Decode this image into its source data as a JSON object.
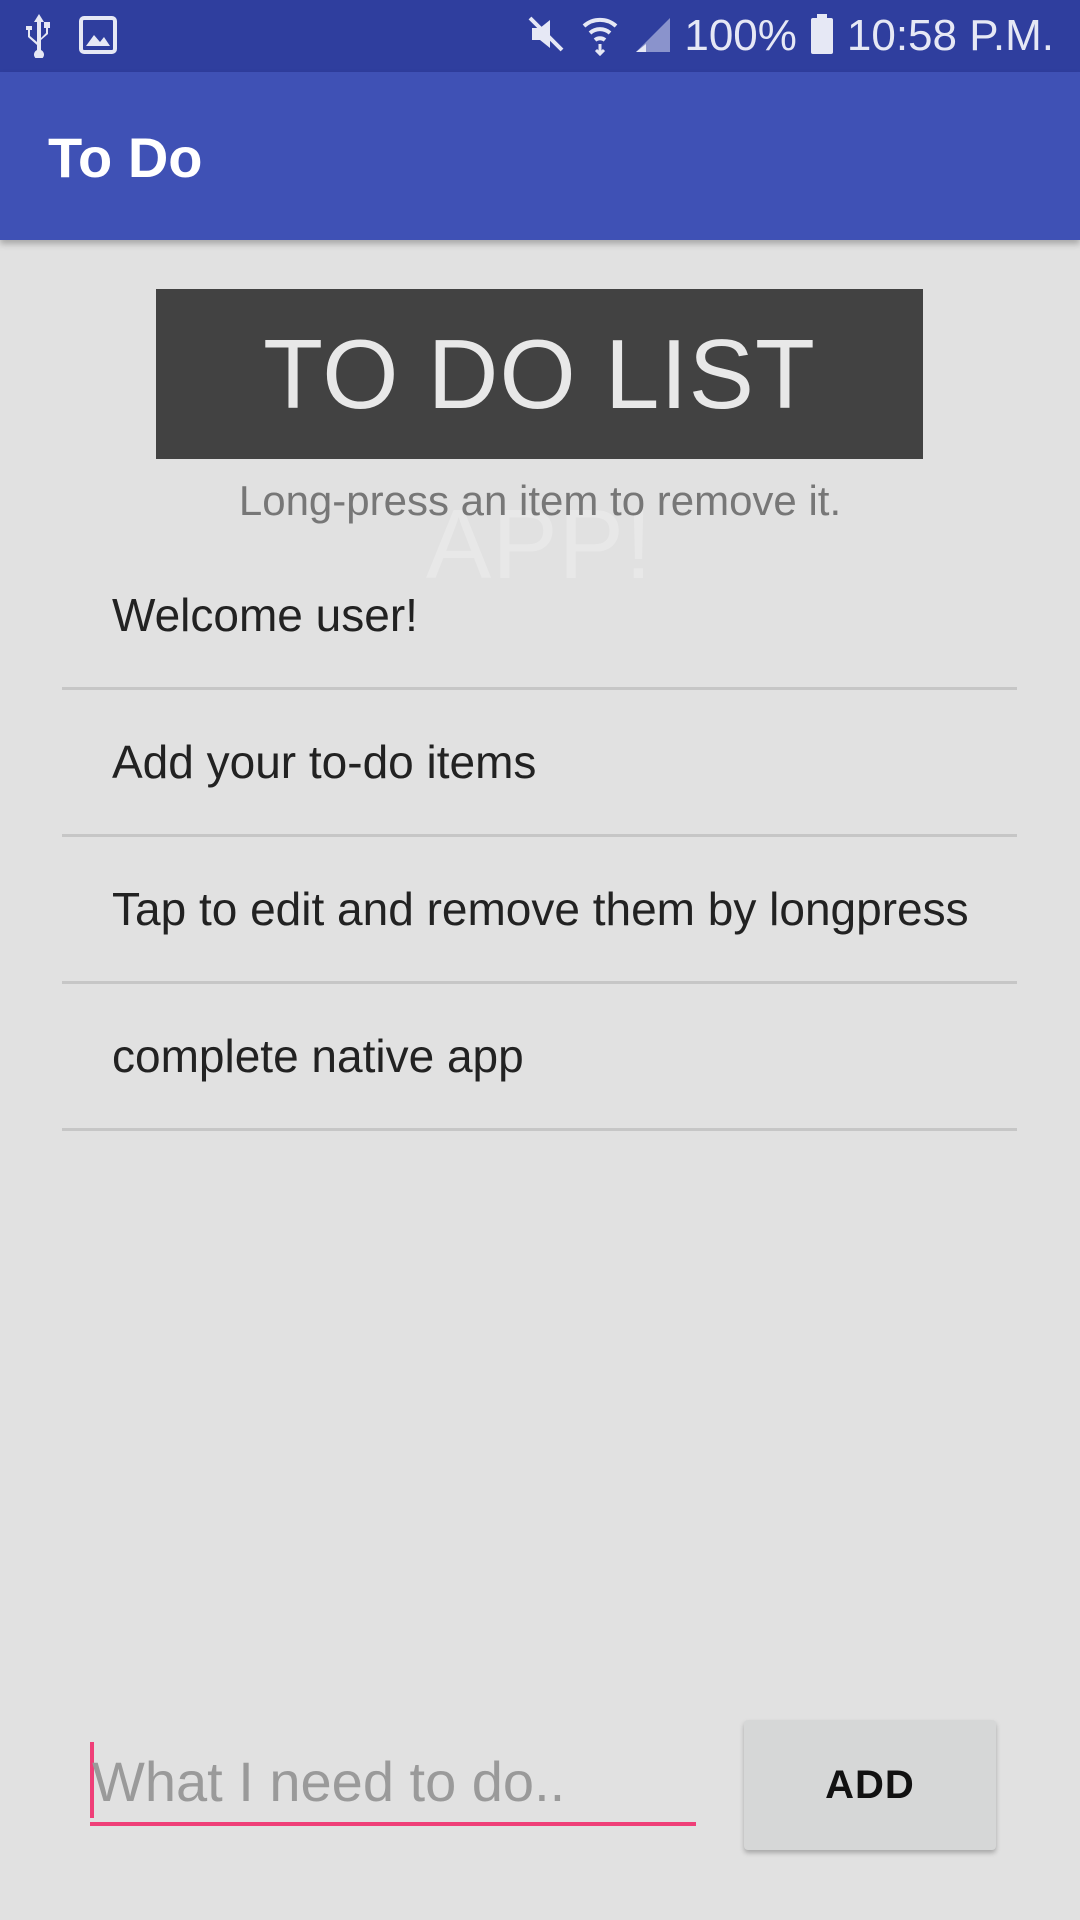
{
  "status_bar": {
    "battery": "100%",
    "time": "10:58 P.M.",
    "icons": [
      "usb-icon",
      "image-icon",
      "mute-icon",
      "wifi-icon",
      "signal-icon",
      "battery-icon"
    ]
  },
  "app_bar": {
    "title": "To Do"
  },
  "banner": {
    "text": "TO DO LIST APP!"
  },
  "hint": "Long-press an item to remove it.",
  "todos": [
    {
      "text": "Welcome user!"
    },
    {
      "text": "Add your to-do items"
    },
    {
      "text": "Tap to edit and remove them by longpress"
    },
    {
      "text": "complete native app"
    }
  ],
  "input": {
    "value": "",
    "placeholder": "What I need to do.."
  },
  "add_button": {
    "label": "ADD"
  },
  "colors": {
    "status_bar": "#2f3e9e",
    "app_bar": "#3f51b5",
    "accent": "#ef3f78",
    "background": "#e1e1e1",
    "banner": "#424242"
  }
}
